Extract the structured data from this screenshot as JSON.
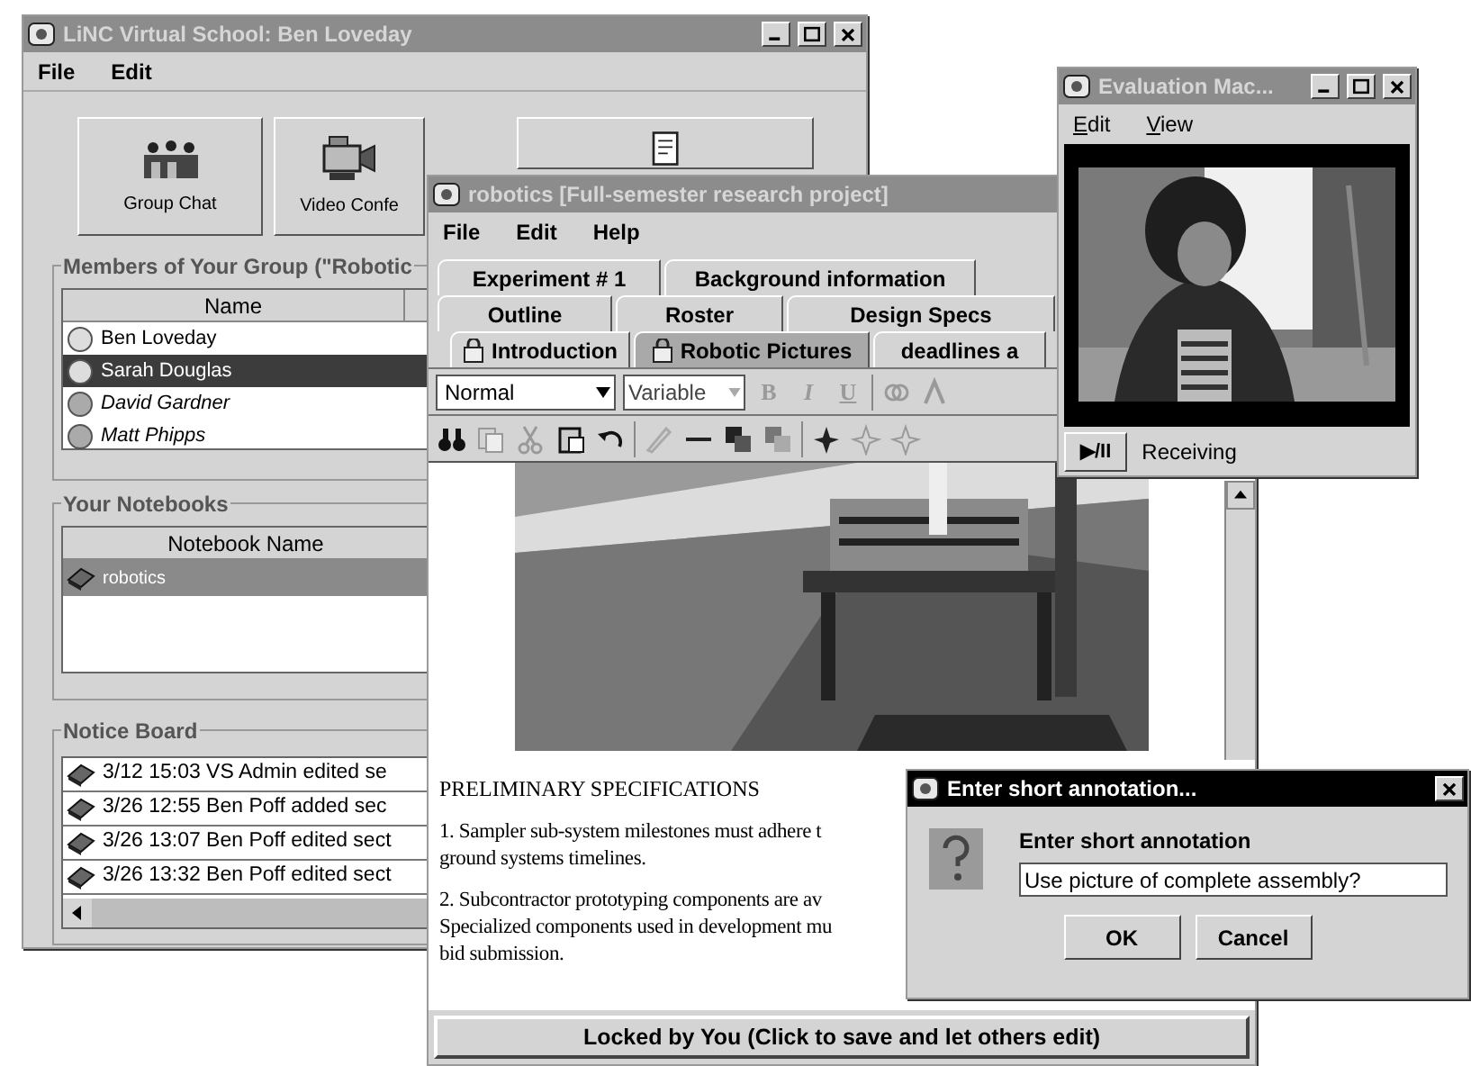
{
  "main_window": {
    "title": "LiNC Virtual School: Ben Loveday",
    "active": false,
    "menu": [
      "File",
      "Edit"
    ],
    "launch_buttons": [
      {
        "label": "Group Chat",
        "kind": "chat"
      },
      {
        "label": "Video Confe",
        "kind": "video"
      },
      {
        "kind": "document"
      }
    ],
    "members": {
      "title": "Members of Your Group (\"Robotic",
      "column": "Name",
      "rows": [
        {
          "name": "Ben Loveday",
          "selected": false,
          "online": true
        },
        {
          "name": "Sarah Douglas",
          "selected": true,
          "online": true
        },
        {
          "name": "David Gardner",
          "selected": false,
          "online": false
        },
        {
          "name": "Matt Phipps",
          "selected": false,
          "online": false
        }
      ]
    },
    "notebooks": {
      "title": "Your Notebooks",
      "column": "Notebook Name",
      "rows": [
        {
          "name": "robotics",
          "selected": true
        }
      ]
    },
    "notice_board": {
      "title": "Notice Board",
      "entries": [
        "3/12 15:03 VS Admin edited se",
        "3/26 12:55 Ben Poff added sec",
        "3/26 13:07 Ben Poff edited sect",
        "3/26 13:32 Ben Poff edited sect"
      ]
    }
  },
  "notebook_window": {
    "title": "robotics [Full-semester research project]",
    "active": false,
    "menu": [
      "File",
      "Edit",
      "Help"
    ],
    "tab_rows": [
      [
        {
          "label": "Experiment # 1",
          "selected": false,
          "locked": false
        },
        {
          "label": "Background information",
          "selected": false,
          "locked": false
        }
      ],
      [
        {
          "label": "Outline",
          "selected": false,
          "locked": false
        },
        {
          "label": "Roster",
          "selected": false,
          "locked": false
        },
        {
          "label": "Design Specs",
          "selected": false,
          "locked": false
        }
      ],
      [
        {
          "label": "Introduction",
          "selected": false,
          "locked": true
        },
        {
          "label": "Robotic Pictures",
          "selected": true,
          "locked": true
        },
        {
          "label": "deadlines a",
          "selected": false,
          "locked": false
        }
      ]
    ],
    "style_dropdown": "Normal",
    "font_dropdown": {
      "value": "Variable",
      "disabled": true
    },
    "format_buttons": [
      {
        "label": "B",
        "disabled": true
      },
      {
        "label": "I",
        "disabled": true
      },
      {
        "label": "U",
        "disabled": true
      }
    ],
    "document": {
      "heading": "PRELIMINARY SPECIFICATIONS",
      "paragraphs": [
        [
          "1. Sampler sub-system milestones must adhere t",
          "ground systems timelines."
        ],
        [
          "2. Subcontractor prototyping components are av",
          "Specialized components used in development mu",
          "bid submission."
        ]
      ]
    },
    "lock_button": "Locked by You (Click to save and let others edit)"
  },
  "video_window": {
    "title": "Evaluation Mac...",
    "active": false,
    "menu": [
      "Edit",
      "View"
    ],
    "play_button": "▶/II",
    "status": "Receiving"
  },
  "annotation_dialog": {
    "title": "Enter short annotation...",
    "active": true,
    "prompt": "Enter short annotation",
    "value": "Use picture of complete assembly?",
    "buttons": [
      "OK",
      "Cancel"
    ]
  }
}
